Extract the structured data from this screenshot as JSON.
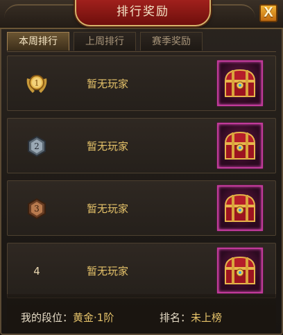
{
  "title": "排行奖励",
  "close_label": "X",
  "tabs": [
    {
      "label": "本周排行",
      "active": true
    },
    {
      "label": "上周排行",
      "active": false
    },
    {
      "label": "赛季奖励",
      "active": false
    }
  ],
  "rows": [
    {
      "rank": "1",
      "medal": "gold",
      "player": "暂无玩家",
      "reward_icon": "treasure-chest"
    },
    {
      "rank": "2",
      "medal": "silver",
      "player": "暂无玩家",
      "reward_icon": "treasure-chest"
    },
    {
      "rank": "3",
      "medal": "bronze",
      "player": "暂无玩家",
      "reward_icon": "treasure-chest"
    },
    {
      "rank": "4",
      "medal": "none",
      "player": "暂无玩家",
      "reward_icon": "treasure-chest"
    }
  ],
  "footer": {
    "tier_label": "我的段位：",
    "tier_value": "黄金·1阶",
    "rank_label": "排名：",
    "rank_value": "未上榜"
  },
  "colors": {
    "accent_gold": "#e6c36a",
    "title_red": "#a0201c",
    "close_orange": "#f2b334",
    "chest_frame_pink": "#c13a9a"
  }
}
